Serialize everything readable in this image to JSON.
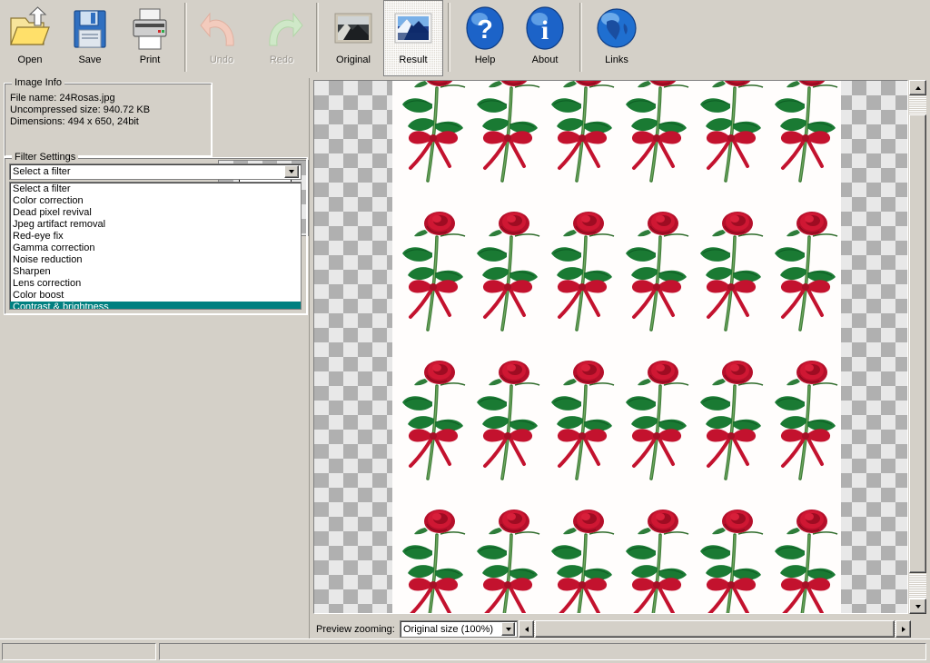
{
  "toolbar": {
    "buttons": [
      {
        "id": "open",
        "label": "Open",
        "icon": "folder-open-icon",
        "state": "enabled"
      },
      {
        "id": "save",
        "label": "Save",
        "icon": "floppy-disk-icon",
        "state": "enabled"
      },
      {
        "id": "print",
        "label": "Print",
        "icon": "printer-icon",
        "state": "enabled"
      },
      {
        "id": "undo",
        "label": "Undo",
        "icon": "undo-arrow-icon",
        "state": "disabled"
      },
      {
        "id": "redo",
        "label": "Redo",
        "icon": "redo-arrow-icon",
        "state": "disabled"
      },
      {
        "id": "original",
        "label": "Original",
        "icon": "photo-original-icon",
        "state": "enabled"
      },
      {
        "id": "result",
        "label": "Result",
        "icon": "photo-result-icon",
        "state": "selected"
      },
      {
        "id": "help",
        "label": "Help",
        "icon": "question-mark-icon",
        "state": "enabled"
      },
      {
        "id": "about",
        "label": "About",
        "icon": "info-icon",
        "state": "enabled"
      },
      {
        "id": "links",
        "label": "Links",
        "icon": "globe-icon",
        "state": "enabled"
      }
    ]
  },
  "image_info": {
    "title": "Image Info",
    "file_name_line": "File name: 24Rosas.jpg",
    "uncompressed_size_line": "Uncompressed size: 940.72 KB",
    "dimensions_line": "Dimensions: 494 x 650, 24bit",
    "file_name": "24Rosas.jpg",
    "uncompressed_size": "940.72 KB",
    "dimensions": "494 x 650, 24bit"
  },
  "filter_settings": {
    "title": "Filter Settings",
    "combo_value": "Select a filter",
    "items": [
      "Select a filter",
      "Color correction",
      "Dead pixel revival",
      "Jpeg artifact removal",
      "Red-eye fix",
      "Gamma correction",
      "Noise reduction",
      "Sharpen",
      "Lens correction",
      "Color boost",
      "Contrast & brightness"
    ],
    "selected_item": "Contrast & brightness",
    "selected_index": 10,
    "selection_color": "#008080"
  },
  "preview": {
    "zoom_label": "Preview zooming:",
    "zoom_value": "Original size (100%)",
    "background": "transparency-checkerboard"
  },
  "status_bar": {
    "pane1": "",
    "pane2": ""
  },
  "colors": {
    "window_bg": "#d4d0c8",
    "field_bg": "#ffffff",
    "selection": "#008080",
    "disabled_text": "#9a968f",
    "rose_red": "#c3122e",
    "leaf_green": "#1f7a34"
  }
}
